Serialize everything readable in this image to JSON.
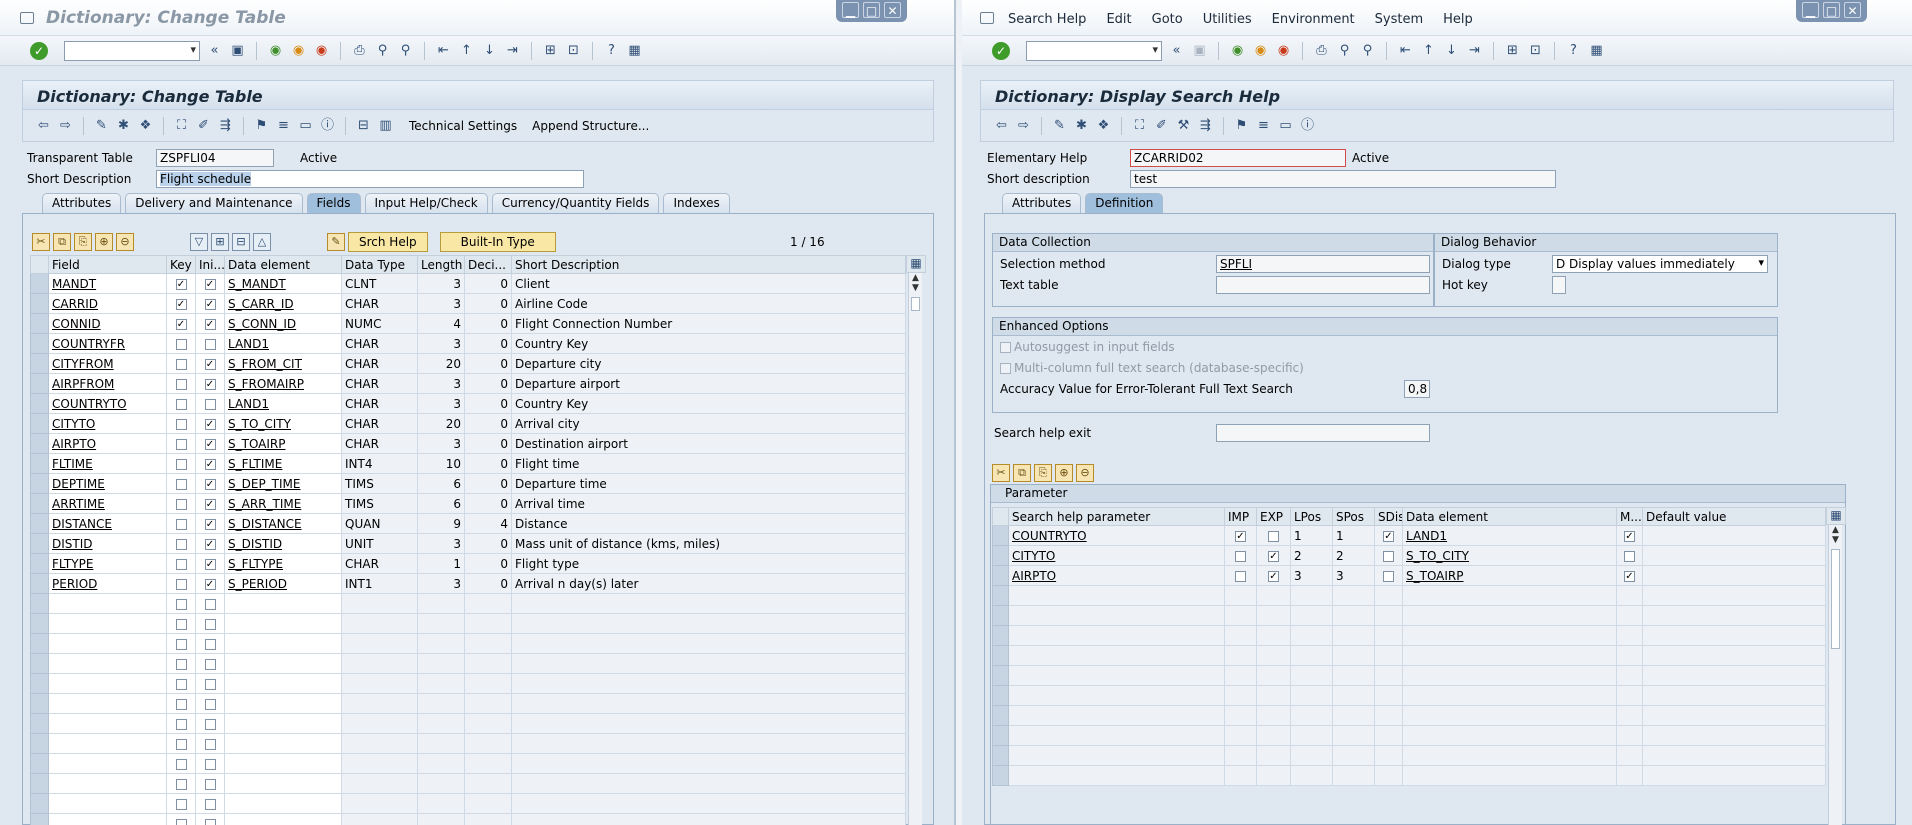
{
  "left": {
    "window_title": "Dictionary: Change Table",
    "screen_title": "Dictionary: Change Table",
    "toolbar_buttons": {
      "technical_settings": "Technical Settings",
      "append_structure": "Append Structure..."
    },
    "header": {
      "transparent_table_label": "Transparent Table",
      "transparent_table_value": "ZSPFLI04",
      "status": "Active",
      "short_description_label": "Short Description",
      "short_description_value": "Flight schedule"
    },
    "tabs": [
      "Attributes",
      "Delivery and Maintenance",
      "Fields",
      "Input Help/Check",
      "Currency/Quantity Fields",
      "Indexes"
    ],
    "active_tab": "Fields",
    "grid_buttons": {
      "srch_help": "Srch Help",
      "built_in_type": "Built-In Type"
    },
    "pager": "1 / 16",
    "columns": [
      "Field",
      "Key",
      "Ini...",
      "Data element",
      "Data Type",
      "Length",
      "Deci...",
      "Short Description"
    ],
    "rows": [
      {
        "field": "MANDT",
        "key": true,
        "ini": true,
        "de": "S_MANDT",
        "type": "CLNT",
        "len": "3",
        "dec": "0",
        "desc": "Client"
      },
      {
        "field": "CARRID",
        "key": true,
        "ini": true,
        "de": "S_CARR_ID",
        "type": "CHAR",
        "len": "3",
        "dec": "0",
        "desc": "Airline Code"
      },
      {
        "field": "CONNID",
        "key": true,
        "ini": true,
        "de": "S_CONN_ID",
        "type": "NUMC",
        "len": "4",
        "dec": "0",
        "desc": "Flight Connection Number"
      },
      {
        "field": "COUNTRYFR",
        "key": false,
        "ini": false,
        "de": "LAND1",
        "type": "CHAR",
        "len": "3",
        "dec": "0",
        "desc": "Country Key"
      },
      {
        "field": "CITYFROM",
        "key": false,
        "ini": true,
        "de": "S_FROM_CIT",
        "type": "CHAR",
        "len": "20",
        "dec": "0",
        "desc": "Departure city"
      },
      {
        "field": "AIRPFROM",
        "key": false,
        "ini": true,
        "de": "S_FROMAIRP",
        "type": "CHAR",
        "len": "3",
        "dec": "0",
        "desc": "Departure airport"
      },
      {
        "field": "COUNTRYTO",
        "key": false,
        "ini": false,
        "de": "LAND1",
        "type": "CHAR",
        "len": "3",
        "dec": "0",
        "desc": "Country Key"
      },
      {
        "field": "CITYTO",
        "key": false,
        "ini": true,
        "de": "S_TO_CITY",
        "type": "CHAR",
        "len": "20",
        "dec": "0",
        "desc": "Arrival city"
      },
      {
        "field": "AIRPTO",
        "key": false,
        "ini": true,
        "de": "S_TOAIRP",
        "type": "CHAR",
        "len": "3",
        "dec": "0",
        "desc": "Destination airport"
      },
      {
        "field": "FLTIME",
        "key": false,
        "ini": true,
        "de": "S_FLTIME",
        "type": "INT4",
        "len": "10",
        "dec": "0",
        "desc": "Flight time"
      },
      {
        "field": "DEPTIME",
        "key": false,
        "ini": true,
        "de": "S_DEP_TIME",
        "type": "TIMS",
        "len": "6",
        "dec": "0",
        "desc": "Departure time"
      },
      {
        "field": "ARRTIME",
        "key": false,
        "ini": true,
        "de": "S_ARR_TIME",
        "type": "TIMS",
        "len": "6",
        "dec": "0",
        "desc": "Arrival time"
      },
      {
        "field": "DISTANCE",
        "key": false,
        "ini": true,
        "de": "S_DISTANCE",
        "type": "QUAN",
        "len": "9",
        "dec": "4",
        "desc": "Distance"
      },
      {
        "field": "DISTID",
        "key": false,
        "ini": true,
        "de": "S_DISTID",
        "type": "UNIT",
        "len": "3",
        "dec": "0",
        "desc": "Mass unit of distance (kms, miles)"
      },
      {
        "field": "FLTYPE",
        "key": false,
        "ini": true,
        "de": "S_FLTYPE",
        "type": "CHAR",
        "len": "1",
        "dec": "0",
        "desc": "Flight type"
      },
      {
        "field": "PERIOD",
        "key": false,
        "ini": true,
        "de": "S_PERIOD",
        "type": "INT1",
        "len": "3",
        "dec": "0",
        "desc": "Arrival n day(s) later"
      }
    ]
  },
  "right": {
    "menu": [
      "Search Help",
      "Edit",
      "Goto",
      "Utilities",
      "Environment",
      "System",
      "Help"
    ],
    "screen_title": "Dictionary: Display Search Help",
    "header": {
      "elementary_help_label": "Elementary Help",
      "elementary_help_value": "ZCARRID02",
      "status": "Active",
      "short_description_label": "Short description",
      "short_description_value": "test"
    },
    "tabs": [
      "Attributes",
      "Definition"
    ],
    "active_tab": "Definition",
    "data_collection": {
      "title": "Data Collection",
      "selection_method_label": "Selection method",
      "selection_method_value": "SPFLI",
      "text_table_label": "Text table",
      "text_table_value": ""
    },
    "dialog_behavior": {
      "title": "Dialog Behavior",
      "dialog_type_label": "Dialog type",
      "dialog_type_value": "D Display values immediately",
      "hot_key_label": "Hot key"
    },
    "enhanced_options": {
      "title": "Enhanced Options",
      "autosuggest": "Autosuggest in input fields",
      "multicolumn": "Multi-column full text search (database-specific)",
      "accuracy_label": "Accuracy Value for Error-Tolerant Full Text Search",
      "accuracy_value": "0,8"
    },
    "search_help_exit_label": "Search help exit",
    "parameter_title": "Parameter",
    "param_columns": [
      "Search help parameter",
      "IMP",
      "EXP",
      "LPos",
      "SPos",
      "SDis",
      "Data element",
      "M...",
      "Default value"
    ],
    "params": [
      {
        "name": "COUNTRYTO",
        "imp": true,
        "exp": false,
        "lpos": "1",
        "spos": "1",
        "sdis": true,
        "de": "LAND1",
        "m": true
      },
      {
        "name": "CITYTO",
        "imp": false,
        "exp": true,
        "lpos": "2",
        "spos": "2",
        "sdis": false,
        "de": "S_TO_CITY",
        "m": false
      },
      {
        "name": "AIRPTO",
        "imp": false,
        "exp": true,
        "lpos": "3",
        "spos": "3",
        "sdis": false,
        "de": "S_TOAIRP",
        "m": true
      }
    ]
  }
}
